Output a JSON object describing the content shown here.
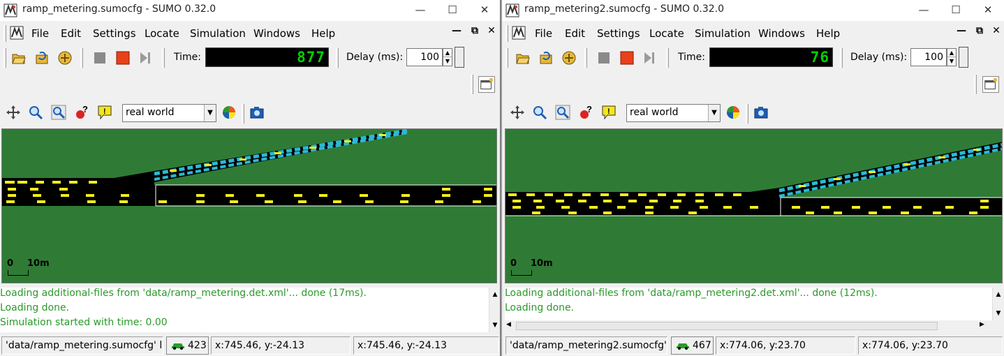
{
  "windows": [
    {
      "title": "ramp_metering.sumocfg - SUMO 0.32.0",
      "menu": [
        "File",
        "Edit",
        "Settings",
        "Locate",
        "Simulation",
        "Windows",
        "Help"
      ],
      "time_label": "Time:",
      "time_value": "877",
      "delay_label": "Delay (ms):",
      "delay_value": "100",
      "color_scheme": "real world",
      "scale_zero": "0",
      "scale_label": "10m",
      "messages": [
        "Loading additional-files from 'data/ramp_metering.det.xml'... done (17ms).",
        "Loading done.",
        "Simulation started with time: 0.00"
      ],
      "status_file": "'data/ramp_metering.sumocfg' lc",
      "vehicle_count": "423",
      "coord_net": "x:745.46, y:-24.13",
      "coord_geo": "x:745.46, y:-24.13"
    },
    {
      "title": "ramp_metering2.sumocfg - SUMO 0.32.0",
      "menu": [
        "File",
        "Edit",
        "Settings",
        "Locate",
        "Simulation",
        "Windows",
        "Help"
      ],
      "time_label": "Time:",
      "time_value": "76",
      "delay_label": "Delay (ms):",
      "delay_value": "100",
      "color_scheme": "real world",
      "scale_zero": "0",
      "scale_label": "10m",
      "messages": [
        "Loading additional-files from 'data/ramp_metering2.det.xml'... done (12ms).",
        "Loading done."
      ],
      "status_file": "'data/ramp_metering2.sumocfg'",
      "vehicle_count": "467",
      "coord_net": "x:774.06, y:23.70",
      "coord_geo": "x:774.06, y:23.70"
    }
  ],
  "colors": {
    "grass": "#2f7b35",
    "road": "#000000",
    "vehicle": "#f2ef1e",
    "ramp_detector": "#2bb9d6",
    "lcd": "#00d000",
    "message": "#2a9a2a"
  },
  "icons": {
    "app": "sumo-app-icon",
    "open": "open-folder-icon",
    "reload": "reload-icon",
    "network": "open-network-icon",
    "stop": "stop-icon",
    "run": "run-icon",
    "step": "step-icon",
    "recenter": "recenter-view-icon",
    "zoom": "zoom-icon",
    "locate": "locate-icon",
    "tracker": "tracker-icon",
    "breakpoint": "breakpoint-icon",
    "edit_coloring": "edit-coloring-icon",
    "screenshot": "screenshot-icon",
    "new_view": "new-view-icon",
    "vehicle": "vehicle-icon"
  }
}
